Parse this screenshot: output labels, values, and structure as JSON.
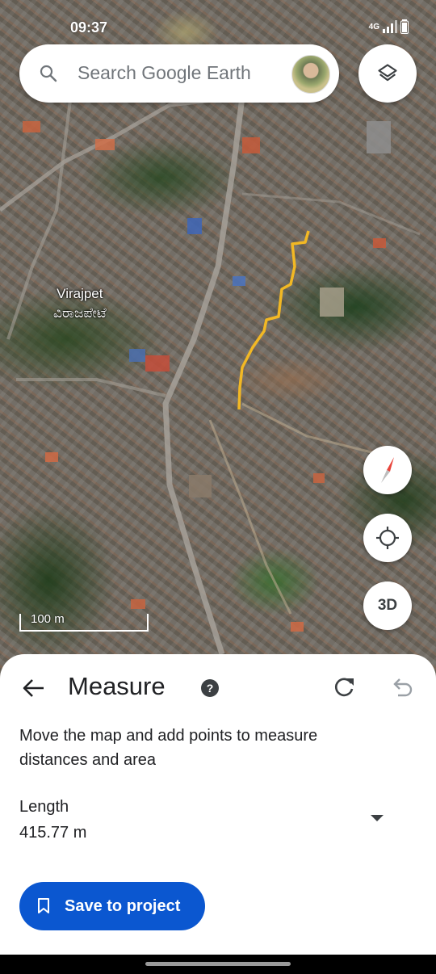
{
  "status_bar": {
    "time": "09:37",
    "network": "4G"
  },
  "search": {
    "placeholder": "Search Google Earth"
  },
  "map": {
    "place_label_en": "Virajpet",
    "place_label_kn": "ವಿರಾಜಪೇಟೆ",
    "scale_label": "100 m",
    "button_3d": "3D"
  },
  "measure": {
    "title": "Measure",
    "instructions": "Move the map and add points to measure distances and area",
    "length_label": "Length",
    "length_value": "415.77 m",
    "save_label": "Save to project"
  },
  "colors": {
    "measure_line": "#f2b824",
    "primary_button": "#0b57d0",
    "compass_red": "#e8453c"
  },
  "icons": {
    "search": "search-icon",
    "layers": "layers-icon",
    "compass": "compass-icon",
    "locate": "my-location-icon",
    "back": "arrow-back-icon",
    "help": "help-icon",
    "redo": "redo-icon",
    "undo": "undo-icon",
    "dropdown": "dropdown-arrow-icon",
    "bookmark": "bookmark-icon"
  }
}
